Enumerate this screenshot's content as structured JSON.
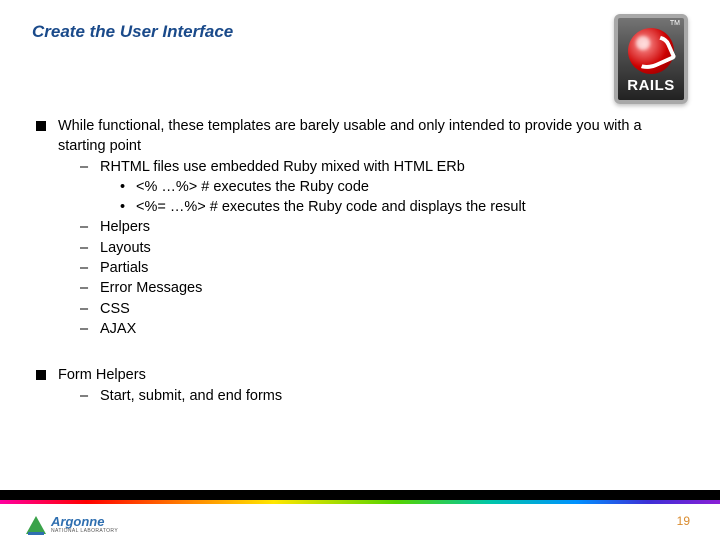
{
  "title": "Create the User Interface",
  "logo": {
    "label": "RAILS",
    "tm": "TM"
  },
  "section1_head": "While functional, these templates are barely usable and only intended to provide you with a starting point",
  "dash1": "RHTML files use embedded Ruby mixed with HTML ERb",
  "dot1": "<% …%> # executes the Ruby code",
  "dot2": "<%= …%> # executes the Ruby code and displays the result",
  "dash_items": [
    "Helpers",
    "Layouts",
    "Partials",
    "Error Messages",
    "CSS",
    "AJAX"
  ],
  "section2_head": "Form Helpers",
  "section2_dash": "Start, submit, and end forms",
  "footer": {
    "org": "Argonne",
    "sub": "NATIONAL LABORATORY"
  },
  "page_number": "19"
}
